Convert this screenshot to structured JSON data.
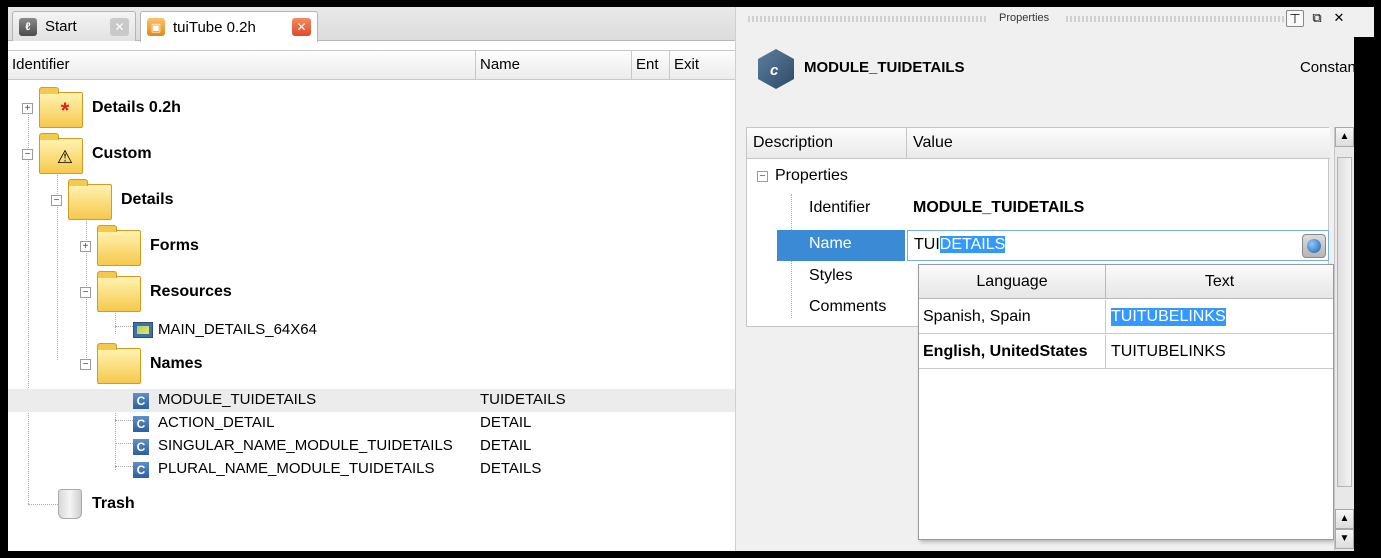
{
  "tabs": [
    {
      "label": "Start",
      "icon": "start-page-icon"
    },
    {
      "label": "tuiTube 0.2h",
      "icon": "project-icon"
    }
  ],
  "tree_columns": [
    "Identifier",
    "Name",
    "Ent",
    "Exit"
  ],
  "tree": {
    "root": {
      "label": "Details 0.2h"
    },
    "custom": {
      "label": "Custom"
    },
    "details": {
      "label": "Details"
    },
    "forms": {
      "label": "Forms"
    },
    "resources": {
      "label": "Resources"
    },
    "resource_item": {
      "label": "MAIN_DETAILS_64X64"
    },
    "names": {
      "label": "Names"
    },
    "constants": [
      {
        "identifier": "MODULE_TUIDETAILS",
        "name": "TUIDETAILS"
      },
      {
        "identifier": "ACTION_DETAIL",
        "name": "DETAIL"
      },
      {
        "identifier": "SINGULAR_NAME_MODULE_TUIDETAILS",
        "name": "DETAIL"
      },
      {
        "identifier": "PLURAL_NAME_MODULE_TUIDETAILS",
        "name": "DETAILS"
      }
    ],
    "trash": {
      "label": "Trash"
    }
  },
  "properties_panel": {
    "title": "Properties",
    "selected_identifier": "MODULE_TUIDETAILS",
    "selected_kind": "Constant",
    "grid_columns": [
      "Description",
      "Value"
    ],
    "group_label": "Properties",
    "rows": {
      "identifier": {
        "label": "Identifier",
        "value": "MODULE_TUIDETAILS"
      },
      "name": {
        "label": "Name",
        "value_prefix": "TUI",
        "value_selected": "DETAILS"
      },
      "styles": {
        "label": "Styles"
      },
      "comments": {
        "label": "Comments"
      }
    }
  },
  "translation_popup": {
    "columns": [
      "Language",
      "Text"
    ],
    "rows": [
      {
        "language": "Spanish, Spain",
        "text": "TUITUBELINKS"
      },
      {
        "language": "English, UnitedStates",
        "text": "TUITUBELINKS"
      }
    ]
  },
  "colors": {
    "selection": "#3399ff",
    "folder": "#f5c94c",
    "constant_icon": "#2c5f9e"
  }
}
